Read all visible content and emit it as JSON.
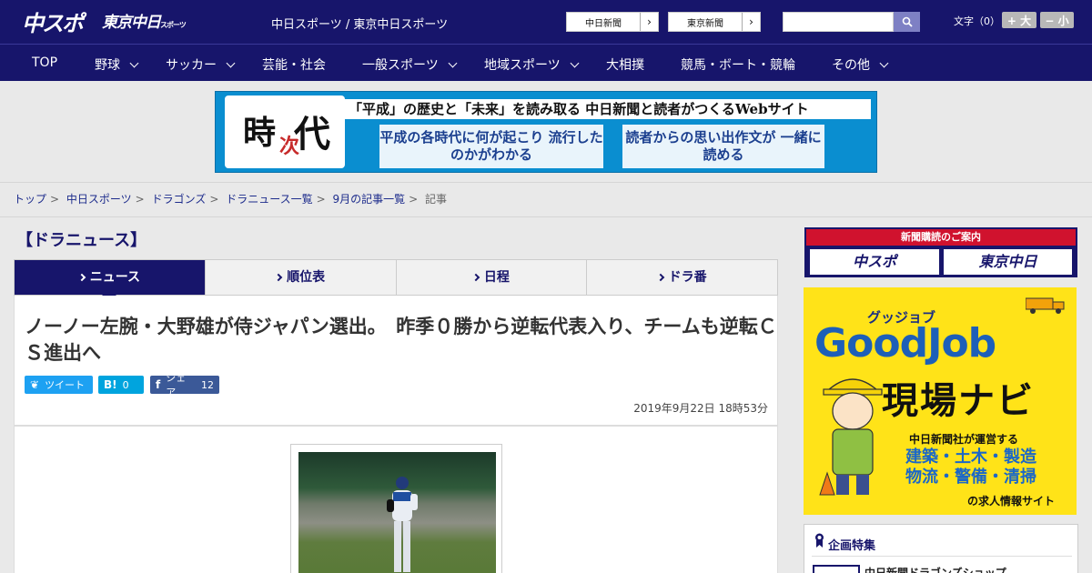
{
  "header": {
    "logo_chuspo": "中スポ",
    "logo_tokyo": "東京中日",
    "logo_tokyo_sub": "スポーツ",
    "site_links": "中日スポーツ / 東京中日スポーツ",
    "paper_buttons": [
      "中日新聞",
      "東京新聞"
    ],
    "search_placeholder": "",
    "fontsize_label": "文字（0）",
    "fontsize_bigger": "+ 大",
    "fontsize_smaller": "− 小"
  },
  "nav": {
    "items": [
      "TOP",
      "野球",
      "サッカー",
      "芸能・社会",
      "一般スポーツ",
      "地域スポーツ",
      "大相撲",
      "競馬・ボート・競輪",
      "その他"
    ]
  },
  "banner": {
    "clock_chars": [
      "時",
      "次",
      "代"
    ],
    "headline": "「平成」の歴史と「未来」を読み取る 中日新聞と読者がつくるWebサイト",
    "box1": "平成の各時代に何が起こり 流行したのかがわかる",
    "box2": "読者からの思い出作文が 一緒に読める"
  },
  "breadcrumb": [
    "トップ",
    "中日スポーツ",
    "ドラゴンズ",
    "ドラニュース一覧",
    "9月の記事一覧",
    "記事"
  ],
  "main": {
    "section_title": "【ドラニュース】",
    "tabs": [
      "ニュース",
      "順位表",
      "日程",
      "ドラ番"
    ],
    "headline": "ノーノー左腕・大野雄が侍ジャパン選出。　昨季０勝から逆転代表入り、チームも逆転ＣＳ進出へ",
    "share": {
      "tweet": "ツイート",
      "hatena_icon": "B!",
      "hatena_count": "0",
      "fb_label": "シェア",
      "fb_count": "12"
    },
    "date": "2019年9月22日 18時53分"
  },
  "sidebar": {
    "subscribe_head": "新聞購読のご案内",
    "subscribe_b1": "中スポ",
    "subscribe_b2": "東京中日",
    "job_kana": "グッジョブ",
    "job_title": "GoodJob",
    "job_nav": "現場ナビ",
    "job_desc": "中日新聞社が運営する",
    "job_list_1": "建築・土木・製造",
    "job_list_2": "物流・警備・清掃",
    "job_site": "の求人情報サイト",
    "feature_title": "企画特集",
    "feature_item": "中日新聞ドラゴンズショップ"
  },
  "colors": {
    "brand_navy": "#17156b",
    "accent_red": "#d0122e",
    "ad_yellow": "#ffe318"
  }
}
